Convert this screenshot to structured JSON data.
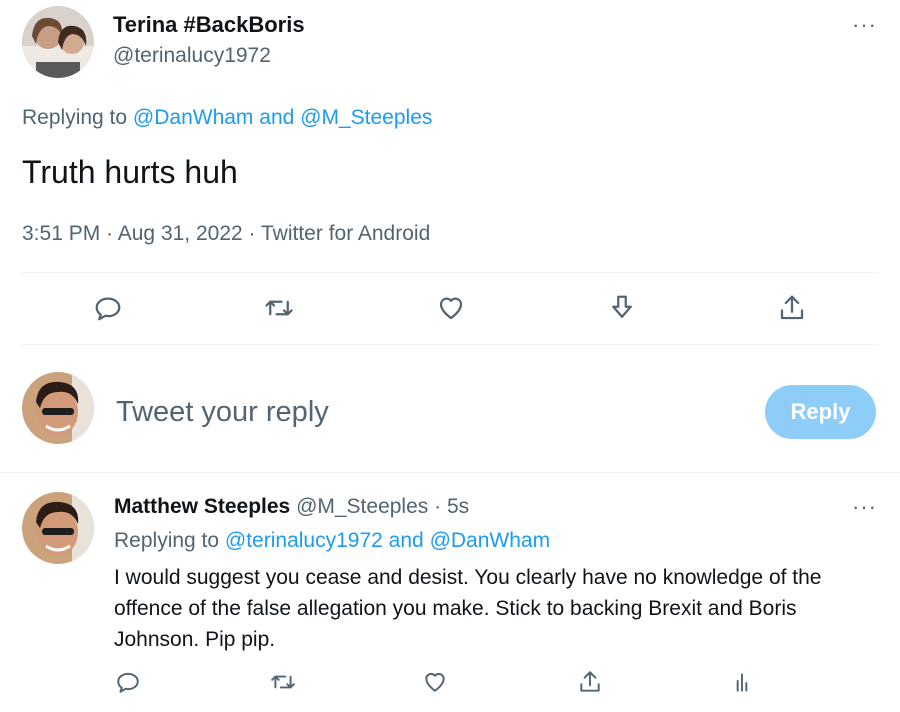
{
  "tweet": {
    "display_name": "Terina #BackBoris",
    "handle": "@terinalucy1972",
    "replying_prefix": "Replying to",
    "replying_user1": "@DanWham",
    "replying_and": "and",
    "replying_user2": "@M_Steeples",
    "text": "Truth hurts huh",
    "time": "3:51 PM",
    "date": "Aug 31, 2022",
    "client": "Twitter for Android",
    "sep": "·",
    "more": "···"
  },
  "actions": [
    "reply-icon",
    "retweet-icon",
    "like-icon",
    "download-icon",
    "share-icon"
  ],
  "composer": {
    "placeholder": "Tweet your reply",
    "button": "Reply"
  },
  "reply": {
    "display_name": "Matthew Steeples",
    "handle": "@M_Steeples",
    "sep": "·",
    "age": "5s",
    "replying_prefix": "Replying to",
    "replying_user1": "@terinalucy1972",
    "replying_and": "and",
    "replying_user2": "@DanWham",
    "line1": "I would suggest you cease and desist. You clearly have no knowledge of the",
    "line2": "offence of the false allegation you make. Stick to backing Brexit and Boris",
    "line3": "Johnson. Pip pip.",
    "more": "···"
  },
  "colors": {
    "accent": "#1d9bf0",
    "muted": "#536471",
    "button_disabled": "#8ecdf8"
  }
}
